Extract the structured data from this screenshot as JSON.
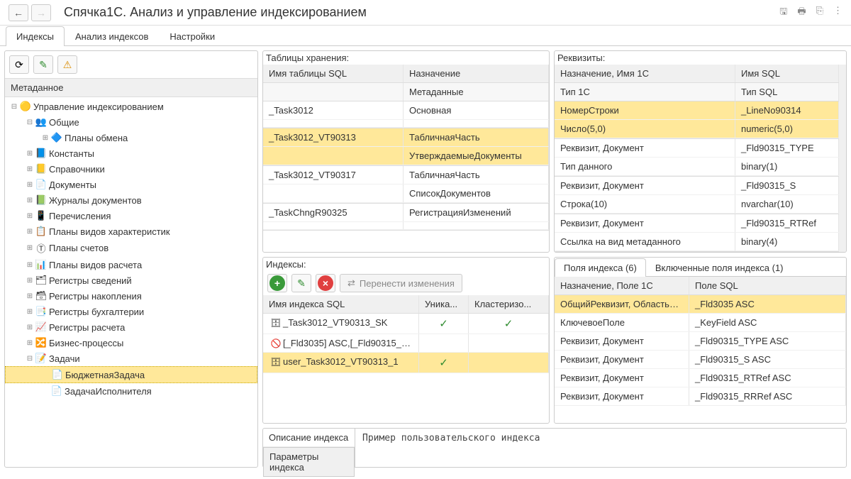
{
  "title": "Спячка1С. Анализ и управление индексированием",
  "main_tabs": [
    "Индексы",
    "Анализ индексов",
    "Настройки"
  ],
  "tree_header": "Метаданное",
  "tree": [
    {
      "depth": 0,
      "exp": "⊟",
      "icon": "🟡",
      "label": "Управление индексированием"
    },
    {
      "depth": 1,
      "exp": "⊟",
      "icon": "👥",
      "label": "Общие"
    },
    {
      "depth": 2,
      "exp": "⊞",
      "icon": "🔷",
      "label": "Планы обмена"
    },
    {
      "depth": 1,
      "exp": "⊞",
      "icon": "📘",
      "label": "Константы"
    },
    {
      "depth": 1,
      "exp": "⊞",
      "icon": "📒",
      "label": "Справочники"
    },
    {
      "depth": 1,
      "exp": "⊞",
      "icon": "📄",
      "label": "Документы"
    },
    {
      "depth": 1,
      "exp": "⊞",
      "icon": "📗",
      "label": "Журналы документов"
    },
    {
      "depth": 1,
      "exp": "⊞",
      "icon": "📱",
      "label": "Перечисления"
    },
    {
      "depth": 1,
      "exp": "⊞",
      "icon": "📋",
      "label": "Планы видов характеристик"
    },
    {
      "depth": 1,
      "exp": "⊞",
      "icon": "Ⓣ",
      "label": "Планы счетов"
    },
    {
      "depth": 1,
      "exp": "⊞",
      "icon": "📊",
      "label": "Планы видов расчета"
    },
    {
      "depth": 1,
      "exp": "⊞",
      "icon": "🗂",
      "label": "Регистры сведений"
    },
    {
      "depth": 1,
      "exp": "⊞",
      "icon": "🗃",
      "label": "Регистры накопления"
    },
    {
      "depth": 1,
      "exp": "⊞",
      "icon": "📑",
      "label": "Регистры бухгалтерии"
    },
    {
      "depth": 1,
      "exp": "⊞",
      "icon": "📈",
      "label": "Регистры расчета"
    },
    {
      "depth": 1,
      "exp": "⊞",
      "icon": "🔀",
      "label": "Бизнес-процессы"
    },
    {
      "depth": 1,
      "exp": "⊟",
      "icon": "📝",
      "label": "Задачи"
    },
    {
      "depth": 2,
      "exp": "",
      "icon": "📄",
      "label": "БюджетнаяЗадача",
      "selected": true
    },
    {
      "depth": 2,
      "exp": "",
      "icon": "📄",
      "label": "ЗадачаИсполнителя"
    }
  ],
  "storage": {
    "title": "Таблицы хранения:",
    "head": [
      "Имя таблицы SQL",
      "Назначение"
    ],
    "subhead": [
      "",
      "Метаданные"
    ],
    "rows": [
      {
        "c": [
          "_Task3012",
          "Основная"
        ],
        "sub": [
          "",
          ""
        ]
      },
      {
        "c": [
          "_Task3012_VT90313",
          "ТабличнаяЧасть"
        ],
        "sub": [
          "",
          "УтверждаемыеДокументы"
        ],
        "sel": true
      },
      {
        "c": [
          "_Task3012_VT90317",
          "ТабличнаяЧасть"
        ],
        "sub": [
          "",
          "СписокДокументов"
        ]
      },
      {
        "c": [
          "_TaskChngR90325",
          "РегистрацияИзменений"
        ],
        "sub": [
          "",
          ""
        ]
      }
    ]
  },
  "req": {
    "title": "Реквизиты:",
    "head": [
      "Назначение, Имя 1С",
      "Имя SQL"
    ],
    "subhead": [
      "Тип 1С",
      "Тип SQL"
    ],
    "rows": [
      {
        "c": [
          "НомерСтроки",
          "_LineNo90314"
        ],
        "sub": [
          "Число(5,0)",
          "numeric(5,0)"
        ],
        "sel": true
      },
      {
        "c": [
          "Реквизит, Документ",
          "_Fld90315_TYPE"
        ],
        "sub": [
          "Тип данного",
          "binary(1)"
        ]
      },
      {
        "c": [
          "Реквизит, Документ",
          "_Fld90315_S"
        ],
        "sub": [
          "Строка(10)",
          "nvarchar(10)"
        ]
      },
      {
        "c": [
          "Реквизит, Документ",
          "_Fld90315_RTRef"
        ],
        "sub": [
          "Ссылка на вид метаданного",
          "binary(4)"
        ]
      }
    ]
  },
  "idx": {
    "title": "Индексы:",
    "transfer_label": "Перенести изменения",
    "head": [
      "Имя индекса SQL",
      "Уника...",
      "Кластеризо..."
    ],
    "rows": [
      {
        "icon": "🗄",
        "name": "_Task3012_VT90313_SK",
        "uniq": true,
        "clus": true
      },
      {
        "icon": "🚫",
        "name": "[_Fld3035] ASC,[_Fld90315_TYP...",
        "uniq": false,
        "clus": false
      },
      {
        "icon": "🗄",
        "name": "user_Task3012_VT90313_1",
        "uniq": true,
        "clus": false,
        "sel": true
      }
    ]
  },
  "fld": {
    "tabs": [
      "Поля индекса (6)",
      "Включенные поля индекса (1)"
    ],
    "head": [
      "Назначение, Поле 1С",
      "Поле SQL"
    ],
    "rows": [
      {
        "c": [
          "ОбщийРеквизит, ОбластьДан...",
          "_Fld3035 ASC"
        ],
        "sel": true
      },
      {
        "c": [
          "КлючевоеПоле",
          "_KeyField ASC"
        ]
      },
      {
        "c": [
          "Реквизит, Документ",
          "_Fld90315_TYPE ASC"
        ]
      },
      {
        "c": [
          "Реквизит, Документ",
          "_Fld90315_S ASC"
        ]
      },
      {
        "c": [
          "Реквизит, Документ",
          "_Fld90315_RTRef ASC"
        ]
      },
      {
        "c": [
          "Реквизит, Документ",
          "_Fld90315_RRRef ASC"
        ]
      }
    ]
  },
  "bottom": {
    "tabs": [
      "Описание индекса",
      "Параметры индекса"
    ],
    "content": "Пример пользовательского индекса"
  }
}
